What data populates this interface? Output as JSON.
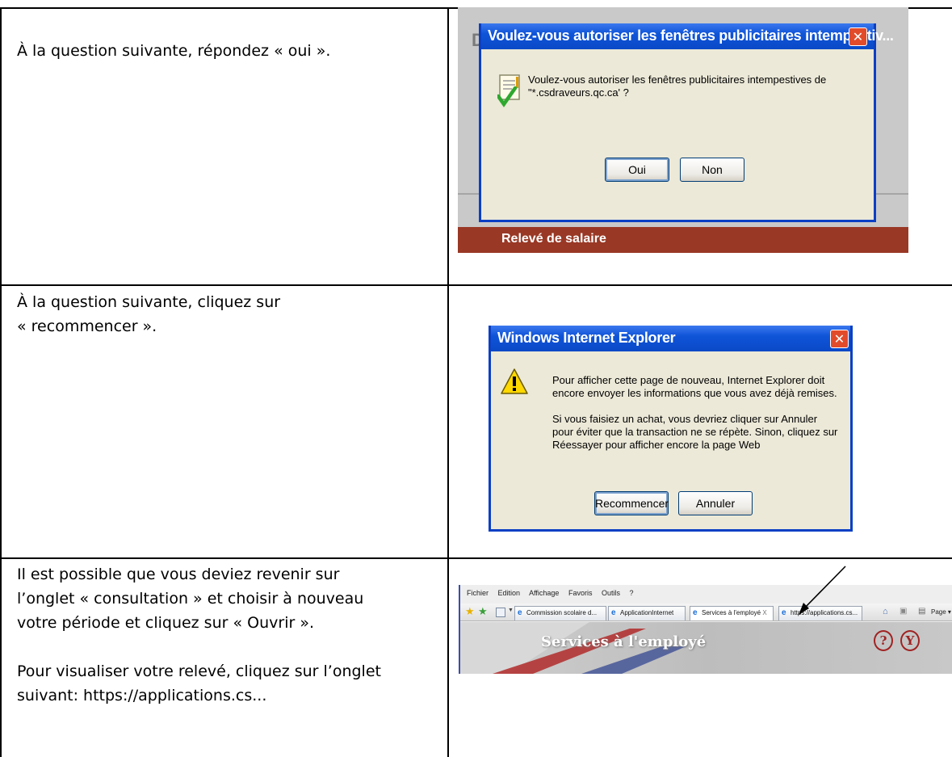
{
  "rows": [
    {
      "instruction_lines": [
        "À la question suivante, répondez « oui »."
      ],
      "dialog": {
        "title": "Voulez-vous autoriser les fenêtres publicitaires intempestiv...",
        "message_lines": [
          "Voulez-vous autoriser les fenêtres publicitaires intempestives de",
          "\"*.csdraveurs.qc.ca' ?"
        ],
        "buttons": [
          "Oui",
          "Non"
        ],
        "background_text": "DAI",
        "bar_text": "Relevé de salaire"
      }
    },
    {
      "instruction_lines": [
        "À la question suivante, cliquez sur",
        "« recommencer »."
      ],
      "dialog": {
        "title": "Windows Internet Explorer",
        "message_lines": [
          "Pour afficher cette page de nouveau, Internet Explorer doit",
          "encore envoyer les informations que vous avez déjà remises.",
          "",
          "Si vous faisiez un achat, vous devriez cliquer sur Annuler",
          "pour éviter que la transaction ne se répète.  Sinon, cliquez sur",
          "Réessayer pour afficher encore la page Web"
        ],
        "buttons": [
          "Recommencer",
          "Annuler"
        ]
      }
    },
    {
      "instruction_lines": [
        "Il est possible que vous deviez revenir sur",
        "l’onglet « consultation » et choisir à nouveau",
        "votre période et cliquez sur « Ouvrir ».",
        "",
        "Pour visualiser votre relevé, cliquez sur l’onglet",
        "suivant: https://applications.cs..."
      ],
      "browser": {
        "menu": [
          "Fichier",
          "Edition",
          "Affichage",
          "Favoris",
          "Outils",
          "?"
        ],
        "tabs": [
          "Commission scolaire d...",
          "ApplicationInternet",
          "Services à l'employé",
          "https://applications.cs..."
        ],
        "tab_close": "X",
        "toolbar_page": "Page",
        "banner_title": "Services à l'employé",
        "icon_help": "?",
        "icon_logout": "Y"
      }
    }
  ]
}
